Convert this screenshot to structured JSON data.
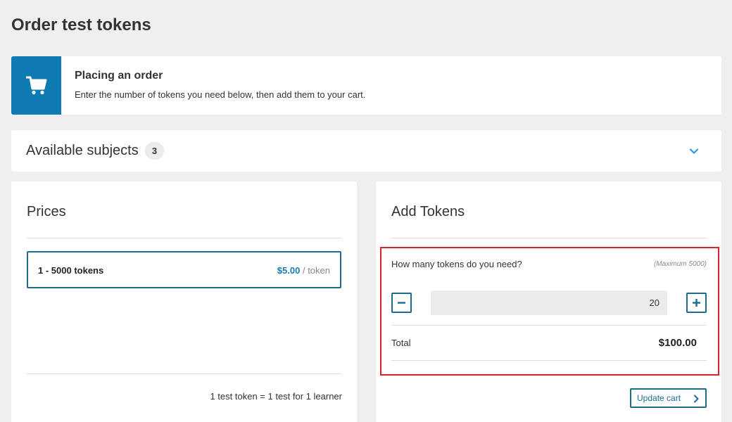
{
  "page": {
    "title": "Order test tokens"
  },
  "banner": {
    "icon": "cart-icon",
    "title": "Placing an order",
    "text": "Enter the number of tokens you need below, then add them to your cart."
  },
  "subjects": {
    "label": "Available subjects",
    "count": "3",
    "icon": "chevron-down-icon"
  },
  "prices": {
    "heading": "Prices",
    "rows": [
      {
        "range": "1 - 5000 tokens",
        "price": "$5.00",
        "unit": "/ token"
      }
    ],
    "note": "1 test token = 1 test for 1 learner"
  },
  "add_tokens": {
    "heading": "Add Tokens",
    "question": "How many tokens do you need?",
    "max_note": "(Maximum 5000)",
    "quantity": "20",
    "decrement_icon": "minus-icon",
    "increment_icon": "plus-icon",
    "total_label": "Total",
    "total_value": "$100.00",
    "update_label": "Update cart",
    "update_icon": "chevron-right-icon"
  },
  "colors": {
    "accent": "#0f7bb3",
    "button_border": "#1d6a93",
    "highlight": "#d9232e",
    "background": "#efefef"
  }
}
